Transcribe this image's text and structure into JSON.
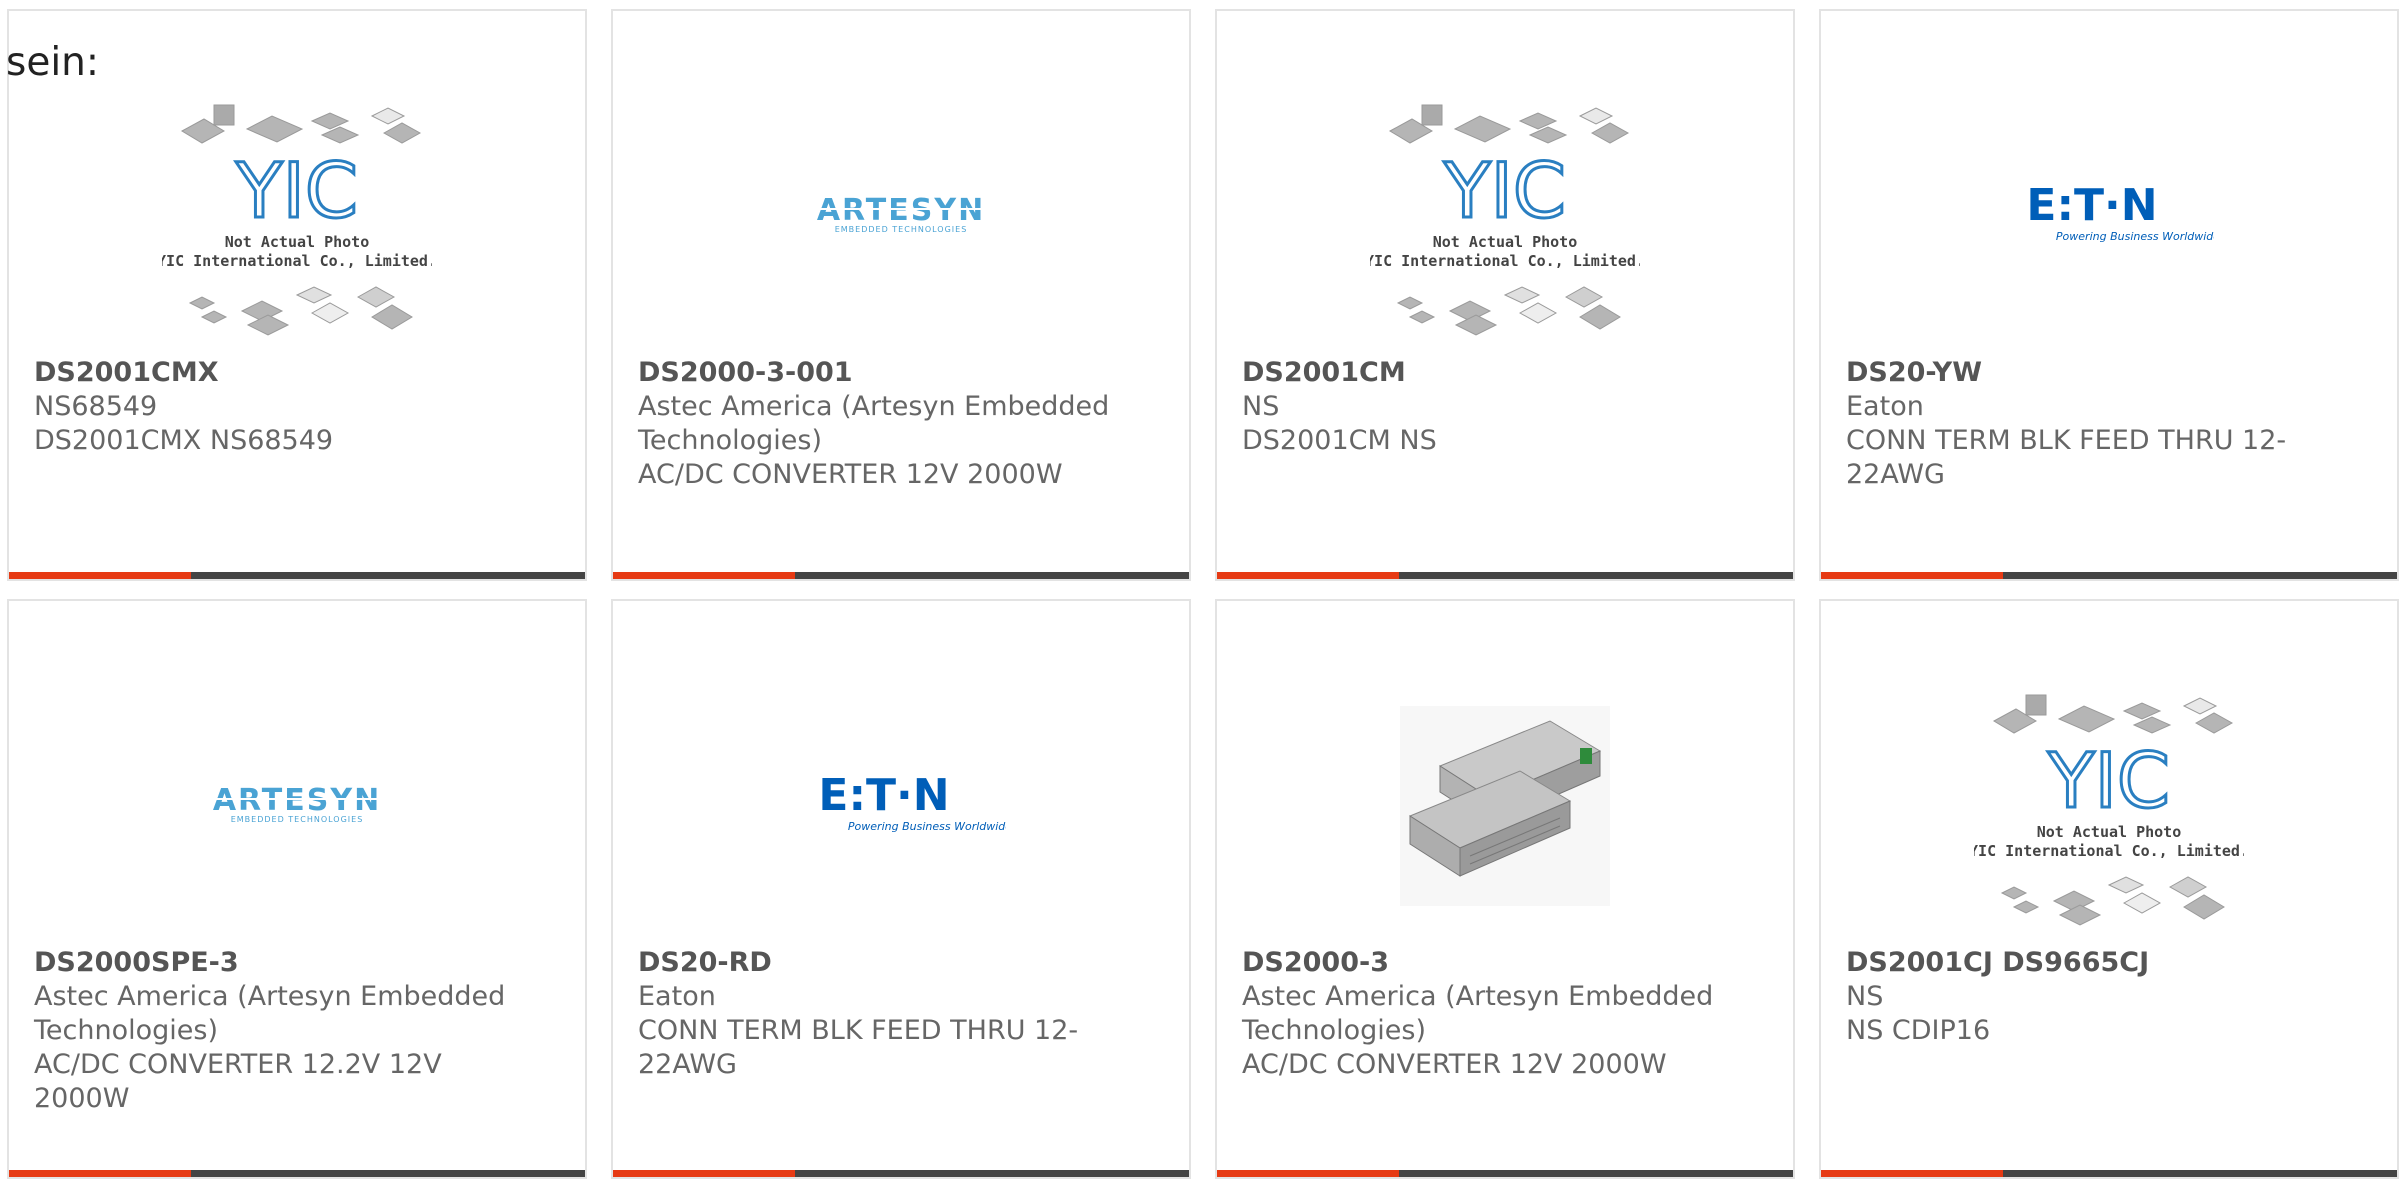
{
  "prefix_text": "sein:",
  "yic_placeholder": {
    "logo_text": "YIC",
    "line1": "Not Actual Photo",
    "line2": "YIC International Co., Limited."
  },
  "artesyn_logo": {
    "name": "ARTESYN",
    "tagline": "EMBEDDED TECHNOLOGIES"
  },
  "eaton_logo": {
    "name": "E:T·N",
    "tagline": "Powering Business Worldwide"
  },
  "colors": {
    "accent": "#e63a14",
    "bar": "#444444",
    "text": "#666666",
    "eaton_blue": "#005eb8",
    "artesyn_blue": "#4aa3d4"
  },
  "products": [
    {
      "part_number": "DS2001CMX",
      "manufacturer": "NS68549",
      "description": "DS2001CMX NS68549",
      "image": "yic-placeholder"
    },
    {
      "part_number": "DS2000-3-001",
      "manufacturer": "Astec America (Artesyn Embedded Technologies)",
      "description": "AC/DC CONVERTER 12V 2000W",
      "image": "artesyn-logo"
    },
    {
      "part_number": "DS2001CM",
      "manufacturer": "NS",
      "description": "DS2001CM NS",
      "image": "yic-placeholder"
    },
    {
      "part_number": "DS20-YW",
      "manufacturer": "Eaton",
      "description": "CONN TERM BLK FEED THRU 12-22AWG",
      "image": "eaton-logo"
    },
    {
      "part_number": "DS2000SPE-3",
      "manufacturer": "Astec America (Artesyn Embedded Technologies)",
      "description": "AC/DC CONVERTER 12.2V 12V 2000W",
      "image": "artesyn-logo"
    },
    {
      "part_number": "DS20-RD",
      "manufacturer": "Eaton",
      "description": "CONN TERM BLK FEED THRU 12-22AWG",
      "image": "eaton-logo"
    },
    {
      "part_number": "DS2000-3",
      "manufacturer": "Astec America (Artesyn Embedded Technologies)",
      "description": "AC/DC CONVERTER 12V 2000W",
      "image": "power-supply-photo"
    },
    {
      "part_number": "DS2001CJ DS9665CJ",
      "manufacturer": "NS",
      "description": "NS CDIP16",
      "image": "yic-placeholder"
    }
  ]
}
